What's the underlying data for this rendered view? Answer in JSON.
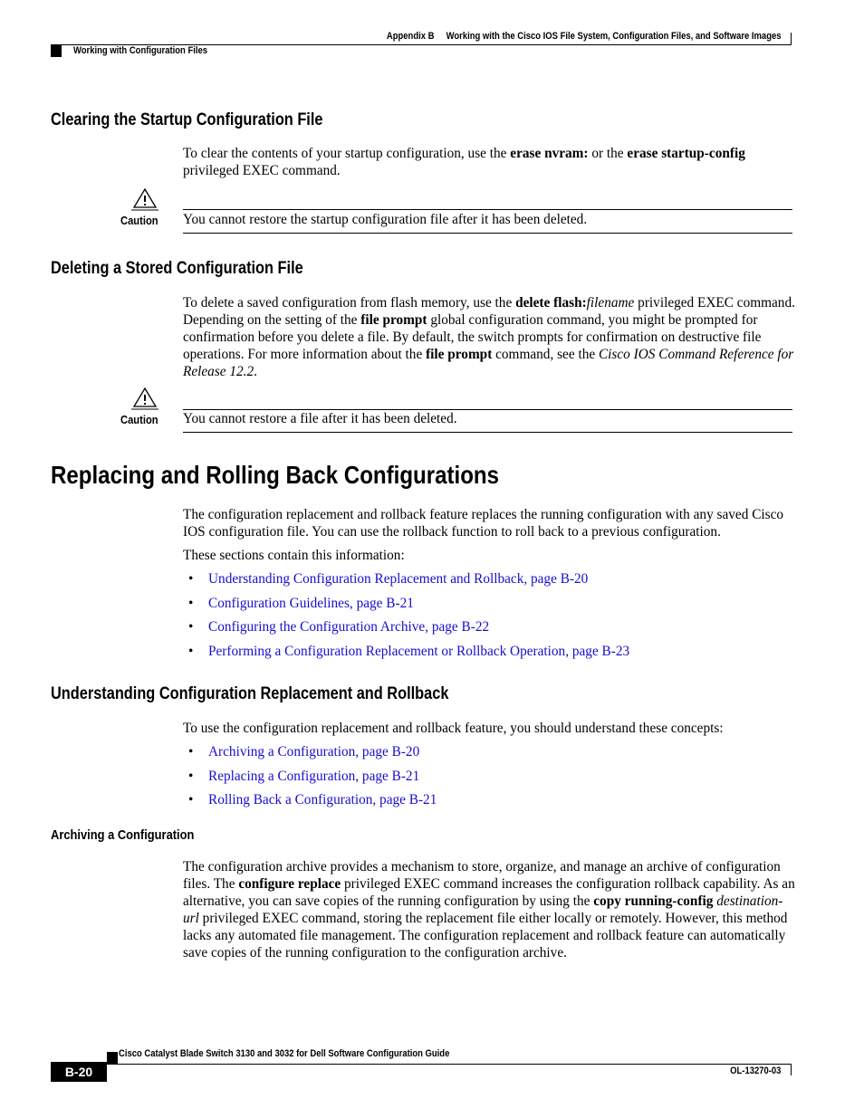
{
  "header": {
    "appendix": "Appendix B",
    "chapter_title": "Working with the Cisco IOS File System, Configuration Files, and Software Images",
    "section": "Working with Configuration Files"
  },
  "sections": {
    "clearing": {
      "title": "Clearing the Startup Configuration File",
      "p1": [
        "To clear the contents of your startup configuration, use the ",
        "erase nvram:",
        " or the ",
        "erase startup-config",
        " privileged EXEC command."
      ],
      "caution_label": "Caution",
      "caution_text": "You cannot restore the startup configuration file after it has been deleted."
    },
    "deleting": {
      "title": "Deleting a Stored Configuration File",
      "p1": [
        "To delete a saved configuration from flash memory, use the ",
        "delete flash:",
        "filename",
        " privileged EXEC command. Depending on the setting of the ",
        "file prompt",
        " global configuration command, you might be prompted for confirmation before you delete a file. By default, the switch prompts for confirmation on destructive file operations. For more information about the ",
        "file prompt",
        " command, see the ",
        "Cisco IOS Command Reference for Release 12.2",
        "."
      ],
      "caution_label": "Caution",
      "caution_text": "You cannot restore a file after it has been deleted."
    },
    "replacing": {
      "title": "Replacing and Rolling Back Configurations",
      "p1": "The configuration replacement and rollback feature replaces the running configuration with any saved Cisco IOS configuration file. You can use the rollback function to roll back to a previous configuration.",
      "p2": "These sections contain this information:",
      "links": [
        "Understanding Configuration Replacement and Rollback, page B-20",
        "Configuration Guidelines, page B-21",
        "Configuring the Configuration Archive, page B-22",
        "Performing a Configuration Replacement or Rollback Operation, page B-23"
      ]
    },
    "understanding": {
      "title": "Understanding Configuration Replacement and Rollback",
      "p1": "To use the configuration replacement and rollback feature, you should understand these concepts:",
      "links": [
        "Archiving a Configuration, page B-20",
        "Replacing a Configuration, page B-21",
        "Rolling Back a Configuration, page B-21"
      ]
    },
    "archiving": {
      "title": "Archiving a Configuration",
      "p1": [
        "The configuration archive provides a mechanism to store, organize, and manage an archive of configuration files. The ",
        "configure replace",
        " privileged EXEC command increases the configuration rollback capability. As an alternative, you can save copies of the running configuration by using the ",
        "copy running-config",
        " ",
        "destination-url",
        " privileged EXEC command, storing the replacement file either locally or remotely. However, this method lacks any automated file management. The configuration replacement and rollback feature can automatically save copies of the running configuration to the configuration archive."
      ]
    }
  },
  "footer": {
    "guide_title": "Cisco Catalyst Blade Switch 3130 and 3032 for Dell Software Configuration Guide",
    "page_number": "B-20",
    "doc_number": "OL-13270-03"
  },
  "colors": {
    "link": "#1a0dcc",
    "text": "#000000"
  }
}
